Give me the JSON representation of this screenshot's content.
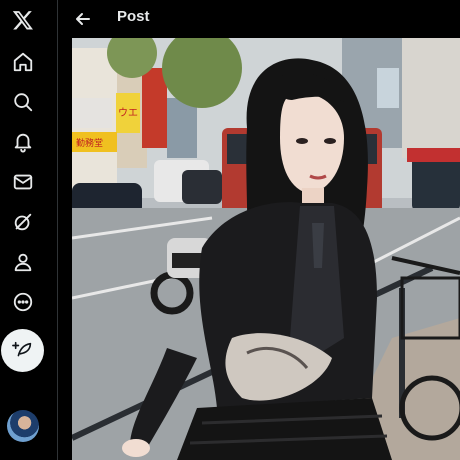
{
  "app": {
    "logo": "x-logo"
  },
  "sidebar": {
    "items": [
      {
        "id": "home",
        "icon": "home-icon"
      },
      {
        "id": "explore",
        "icon": "search-icon"
      },
      {
        "id": "notifications",
        "icon": "bell-icon"
      },
      {
        "id": "messages",
        "icon": "mail-icon"
      },
      {
        "id": "grok",
        "icon": "grok-icon"
      },
      {
        "id": "profile",
        "icon": "person-icon"
      },
      {
        "id": "more",
        "icon": "more-icon"
      }
    ],
    "compose_icon": "feather-plus-icon"
  },
  "header": {
    "back_icon": "arrow-left-icon",
    "title": "Post"
  },
  "media": {
    "kind": "photo",
    "description_icon": "street-photo",
    "storefront_signs": [
      "ウエ",
      "勤務堂"
    ]
  },
  "colors": {
    "background": "#000000",
    "text": "#e7e9ea",
    "divider": "#2f3336",
    "compose_bg": "#eff3f4"
  }
}
